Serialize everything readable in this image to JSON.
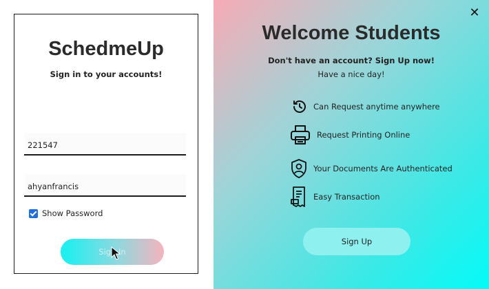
{
  "login": {
    "app_title": "SchedmeUp",
    "subtitle": "Sign in to your accounts!",
    "username_value": "221547",
    "password_value": "ahyanfrancis",
    "show_password_label": "Show Password",
    "show_password_checked": true,
    "signin_label": "Sign In"
  },
  "welcome": {
    "title": "Welcome Students",
    "no_account": "Don't have an account? Sign Up now!",
    "greeting": "Have a nice day!",
    "features": [
      {
        "label": "Can Request anytime anywhere",
        "icon": "refresh-clock-icon"
      },
      {
        "label": "Request Printing Online",
        "icon": "printer-icon"
      },
      {
        "label": "Your Documents Are Authenticated",
        "icon": "shield-user-icon"
      },
      {
        "label": "Easy Transaction",
        "icon": "receipt-icon"
      }
    ],
    "signup_label": "Sign Up",
    "close_glyph": "✕"
  },
  "colors": {
    "accent_cyan": "#14f1f1",
    "accent_pink": "#f6b3bd",
    "checkbox_blue": "#1f6fde",
    "signup_button": "#8ff0f0"
  }
}
